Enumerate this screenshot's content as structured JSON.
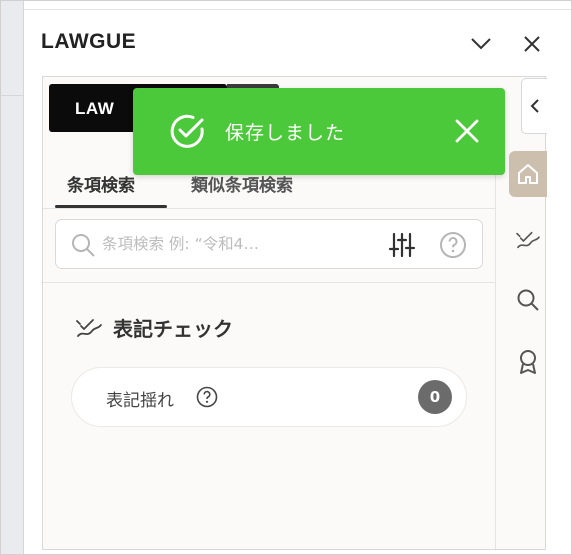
{
  "header": {
    "title": "LAWGUE"
  },
  "brand": {
    "logo_text": "LAW"
  },
  "tabs": [
    {
      "label": "条項検索",
      "active": true
    },
    {
      "label": "類似条項検索",
      "active": false
    }
  ],
  "search": {
    "value": "",
    "placeholder": "条項検索 例: “令和4…"
  },
  "notation": {
    "title": "表記チェック",
    "items": [
      {
        "label": "表記揺れ",
        "count": "0"
      }
    ]
  },
  "toast": {
    "message": "保存しました"
  },
  "colors": {
    "toast_bg": "#4cc93a",
    "rail_active": "#cdbfae",
    "count_badge": "#6b6b6b"
  },
  "icons": {
    "header": [
      "chevron-down-icon",
      "close-icon"
    ],
    "rail": [
      "home-icon",
      "notation-check-icon",
      "search-icon",
      "award-icon"
    ],
    "toast": [
      "check-circle-icon",
      "close-icon"
    ]
  }
}
